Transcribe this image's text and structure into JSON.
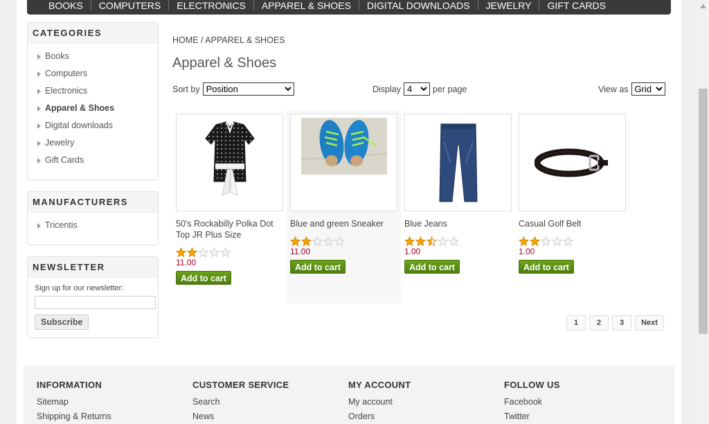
{
  "nav": {
    "items": [
      "BOOKS",
      "COMPUTERS",
      "ELECTRONICS",
      "APPAREL & SHOES",
      "DIGITAL DOWNLOADS",
      "JEWELRY",
      "GIFT CARDS"
    ]
  },
  "categories": {
    "title": "CATEGORIES",
    "items": [
      {
        "label": "Books"
      },
      {
        "label": "Computers"
      },
      {
        "label": "Electronics"
      },
      {
        "label": "Apparel & Shoes"
      },
      {
        "label": "Digital downloads"
      },
      {
        "label": "Jewelry"
      },
      {
        "label": "Gift Cards"
      }
    ],
    "active": "Apparel & Shoes"
  },
  "manufacturers": {
    "title": "MANUFACTURERS",
    "items": [
      {
        "label": "Tricentis"
      }
    ]
  },
  "newsletter": {
    "title": "NEWSLETTER",
    "label": "Sign up for our newsletter:",
    "input_value": "",
    "subscribe_label": "Subscribe"
  },
  "breadcrumb": {
    "home": "HOME",
    "separator": "/",
    "current": "APPAREL & SHOES"
  },
  "page_title": "Apparel & Shoes",
  "controls": {
    "sort_label": "Sort by",
    "sort_value": "Position",
    "display_label": "Display",
    "display_value": "4",
    "per_page_label": "per page",
    "view_label": "View as",
    "view_value": "Grid"
  },
  "products": [
    {
      "title": "50's Rockabilly Polka Dot Top JR Plus Size",
      "rating": 2,
      "price": "11.00",
      "button": "Add to cart",
      "image": "polka-dot-top"
    },
    {
      "title": "Blue and green Sneaker",
      "rating": 2,
      "price": "11.00",
      "button": "Add to cart",
      "image": "sneaker"
    },
    {
      "title": "Blue Jeans",
      "rating": 2.5,
      "price": "1.00",
      "button": "Add to cart",
      "image": "jeans"
    },
    {
      "title": "Casual Golf Belt",
      "rating": 2,
      "price": "1.00",
      "button": "Add to cart",
      "image": "belt"
    }
  ],
  "pager": {
    "pages": [
      "1",
      "2",
      "3"
    ],
    "next": "Next"
  },
  "footer": {
    "information": {
      "title": "INFORMATION",
      "links": [
        "Sitemap",
        "Shipping & Returns"
      ]
    },
    "customer_service": {
      "title": "CUSTOMER SERVICE",
      "links": [
        "Search",
        "News"
      ]
    },
    "my_account": {
      "title": "MY ACCOUNT",
      "links": [
        "My account",
        "Orders"
      ]
    },
    "follow_us": {
      "title": "FOLLOW US",
      "links": [
        "Facebook",
        "Twitter"
      ]
    }
  },
  "colors": {
    "price": "#a5002a",
    "add_to_cart": "#5e8e14",
    "nav_bg": "#3a3a3a",
    "star": "#f5a300"
  }
}
